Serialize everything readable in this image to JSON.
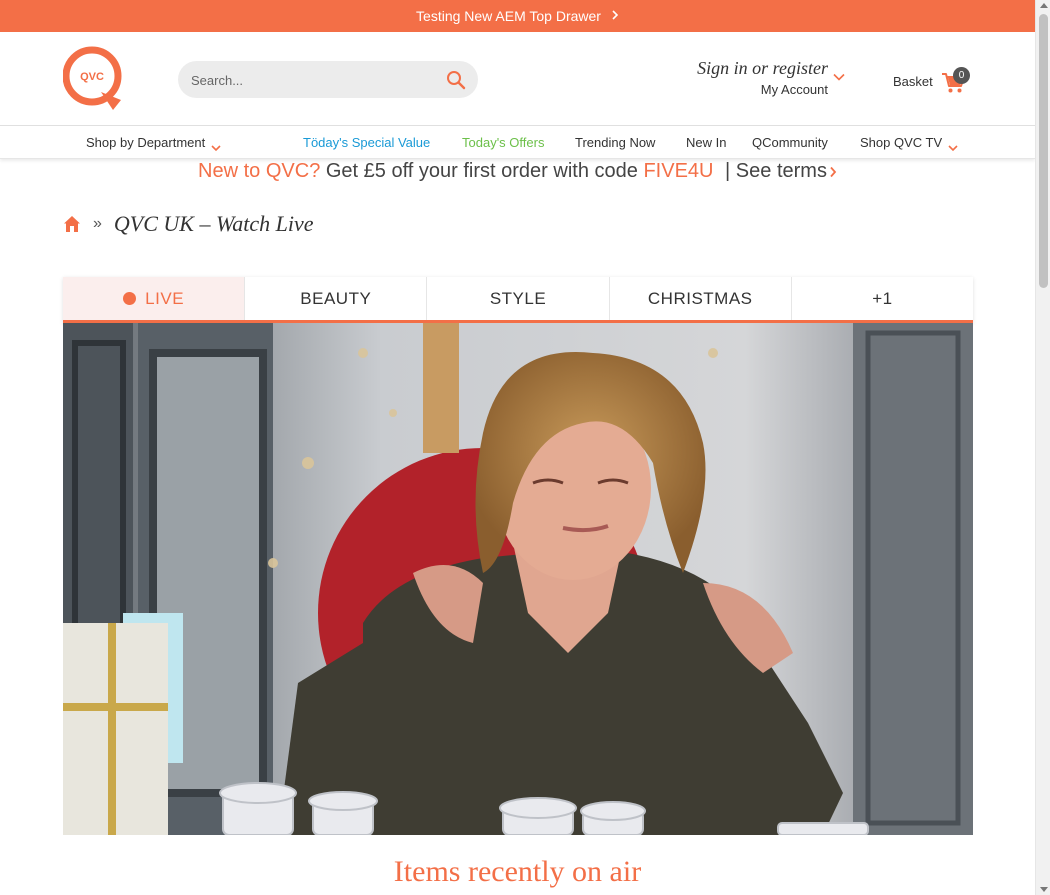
{
  "promo": {
    "text": "Testing New AEM Top Drawer",
    "icon": "chevron-right-icon"
  },
  "header": {
    "logo_text": "QVC",
    "search": {
      "placeholder": "Search...",
      "value": ""
    },
    "account": {
      "signin": "Sign in or register",
      "my_account": "My Account"
    },
    "basket": {
      "label": "Basket",
      "count": "0"
    }
  },
  "nav": {
    "items": [
      {
        "label": "Shop by Department",
        "dropdown": true
      },
      {
        "label": "Töday's Special Value",
        "color": "#1a9ad6"
      },
      {
        "label": "Today's Offers",
        "color": "#6cc04a"
      },
      {
        "label": "Trending Now"
      },
      {
        "label": "New In"
      },
      {
        "label": "QCommunity"
      },
      {
        "label": "Shop QVC TV",
        "dropdown": true
      }
    ]
  },
  "offer": {
    "highlight": "New to QVC?",
    "text": "Get £5 off your first order with code",
    "code": "FIVE4U",
    "terms": "| See terms"
  },
  "breadcrumb": {
    "separator": "»",
    "title": "QVC UK – Watch Live"
  },
  "tabs": [
    {
      "label": "LIVE",
      "active": true
    },
    {
      "label": "BEAUTY"
    },
    {
      "label": "STYLE"
    },
    {
      "label": "CHRISTMAS"
    },
    {
      "label": "+1"
    }
  ],
  "recent": {
    "heading": "Items recently on air"
  },
  "colors": {
    "accent": "#f36f47",
    "tsv_blue": "#1a9ad6",
    "offers_green": "#6cc04a"
  }
}
